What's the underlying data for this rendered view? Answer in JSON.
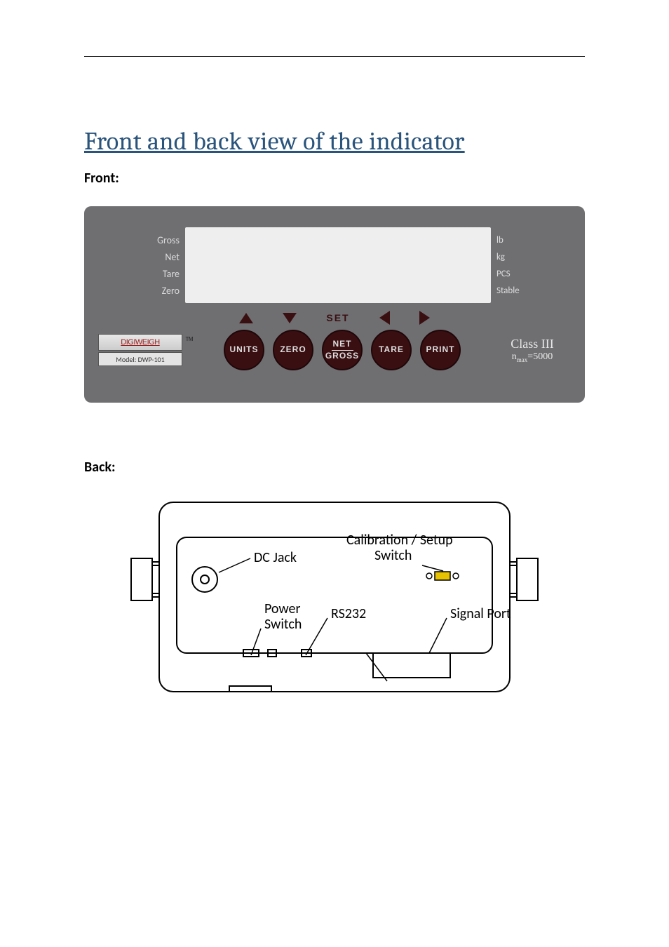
{
  "title": "Front and back view of the indicator",
  "front": {
    "heading": "Front:",
    "left_labels": [
      "Gross",
      "Net",
      "Tare",
      "Zero"
    ],
    "right_labels": [
      "lb",
      "kg",
      "PCS",
      "Stable"
    ],
    "secondary_set_label": "SET",
    "logo_text": "DIGIWEIGH",
    "logo_tm": "TM",
    "model_label": "Model: DWP-101",
    "buttons": {
      "units": "UNITS",
      "zero": "ZERO",
      "net": "NET",
      "gross": "GROSS",
      "tare": "TARE",
      "print": "PRINT"
    },
    "class_line1": "Class III",
    "class_line2_prefix": "n",
    "class_line2_sub": "max",
    "class_line2_suffix": "=5000"
  },
  "back": {
    "heading": "Back:",
    "labels": {
      "dc_jack": "DC Jack",
      "calib": "Calibration / Setup",
      "calib2": "Switch",
      "power": "Power",
      "power2": "Switch",
      "rs232": "RS232",
      "signal": "Signal Port"
    }
  }
}
